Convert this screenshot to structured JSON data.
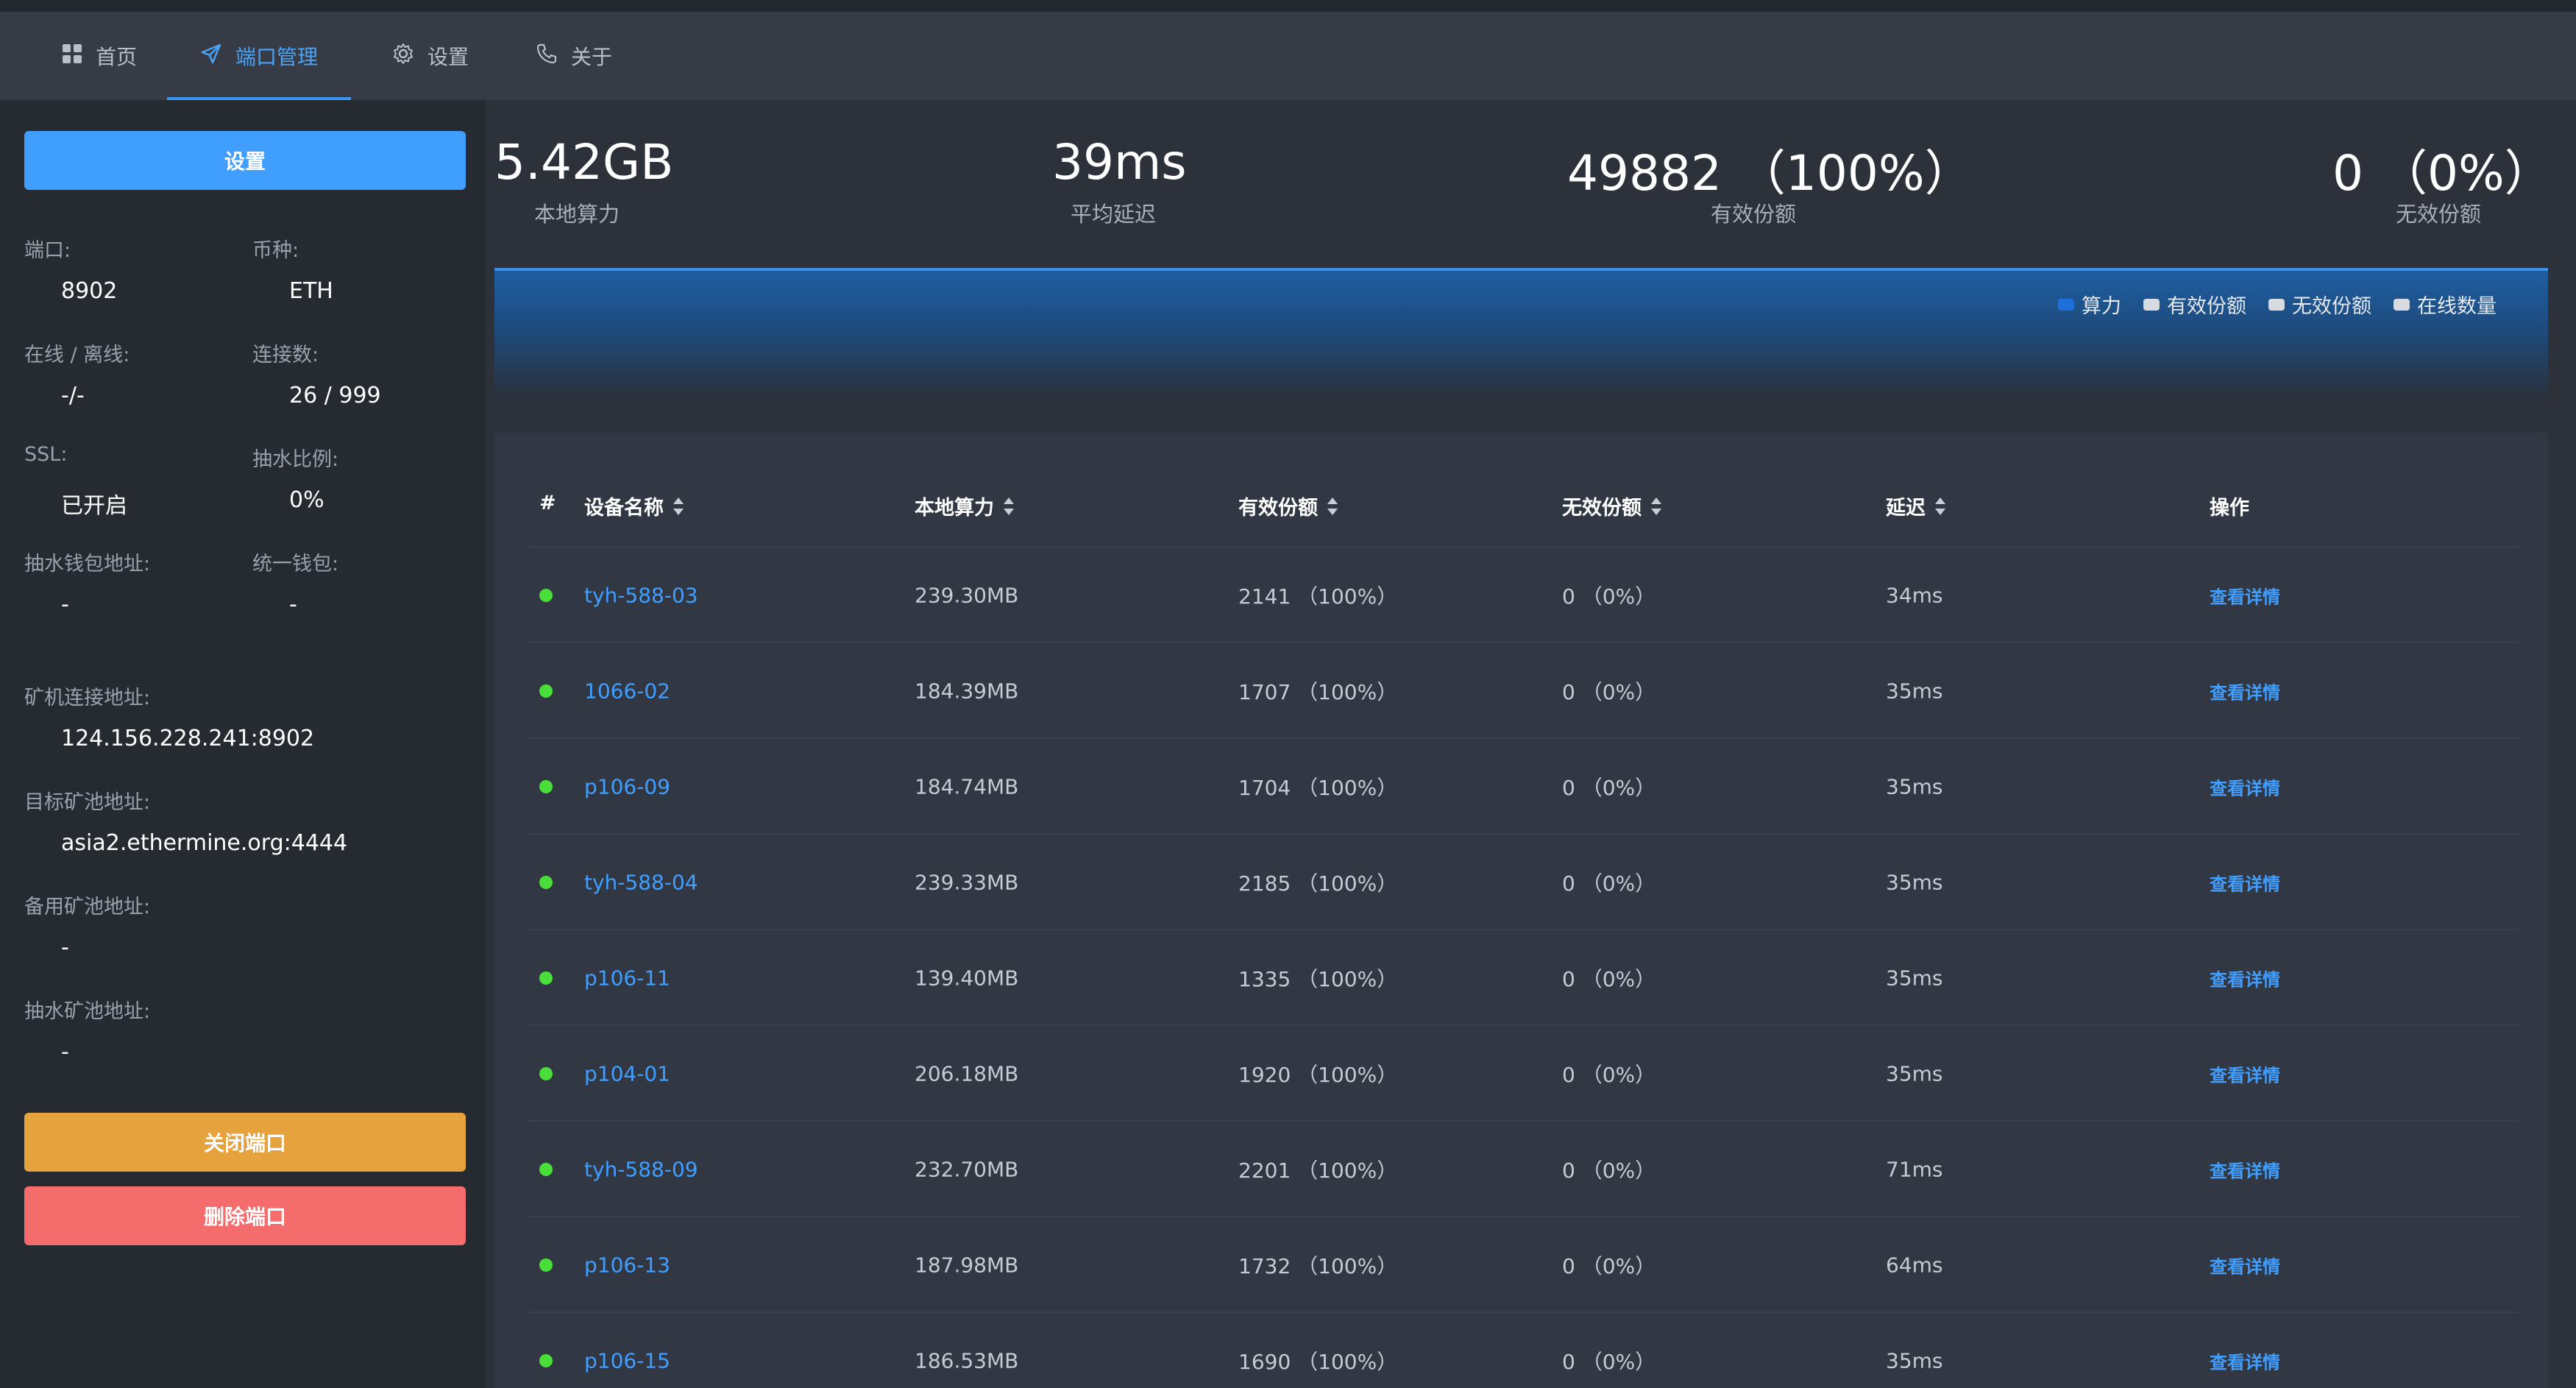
{
  "nav": {
    "items": [
      {
        "label": "首页",
        "icon": "grid-icon"
      },
      {
        "label": "端口管理",
        "icon": "send-icon"
      },
      {
        "label": "设置",
        "icon": "gear-icon"
      },
      {
        "label": "关于",
        "icon": "phone-icon"
      }
    ],
    "active_index": 1
  },
  "sidebar": {
    "settings_button": "设置",
    "port_label": "端口:",
    "port_value": "8902",
    "coin_label": "币种:",
    "coin_value": "ETH",
    "online_label": "在线 / 离线:",
    "online_value": "-/-",
    "connections_label": "连接数:",
    "connections_value": "26 / 999",
    "ssl_label": "SSL:",
    "ssl_value": "已开启",
    "fee_label": "抽水比例:",
    "fee_value": "0%",
    "fee_wallet_label": "抽水钱包地址:",
    "fee_wallet_value": "-",
    "unified_wallet_label": "统一钱包:",
    "unified_wallet_value": "-",
    "miner_addr_label": "矿机连接地址:",
    "miner_addr_value": "124.156.228.241:8902",
    "target_pool_label": "目标矿池地址:",
    "target_pool_value": "asia2.ethermine.org:4444",
    "backup_pool_label": "备用矿池地址:",
    "backup_pool_value": "-",
    "fee_pool_label": "抽水矿池地址:",
    "fee_pool_value": "-",
    "close_button": "关闭端口",
    "delete_button": "删除端口"
  },
  "stats": {
    "hashrate_value": "5.42GB",
    "hashrate_label": "本地算力",
    "latency_value": "39ms",
    "latency_label": "平均延迟",
    "valid_value": "49882 （100%）",
    "valid_label": "有效份额",
    "invalid_value": "0 （0%）",
    "invalid_label": "无效份额"
  },
  "chart_legend": [
    {
      "label": "算力",
      "color": "#1e6fd9"
    },
    {
      "label": "有效份额",
      "color": "#d8dbe0"
    },
    {
      "label": "无效份额",
      "color": "#d8dbe0"
    },
    {
      "label": "在线数量",
      "color": "#d8dbe0"
    }
  ],
  "table": {
    "headers": {
      "index": "#",
      "device": "设备名称",
      "hashrate": "本地算力",
      "valid": "有效份额",
      "invalid": "无效份额",
      "latency": "延迟",
      "action": "操作"
    },
    "rows": [
      {
        "device": "tyh-588-03",
        "hashrate": "239.30MB",
        "valid": "2141 （100%）",
        "invalid": "0 （0%）",
        "latency": "34ms",
        "action": "查看详情"
      },
      {
        "device": "1066-02",
        "hashrate": "184.39MB",
        "valid": "1707 （100%）",
        "invalid": "0 （0%）",
        "latency": "35ms",
        "action": "查看详情"
      },
      {
        "device": "p106-09",
        "hashrate": "184.74MB",
        "valid": "1704 （100%）",
        "invalid": "0 （0%）",
        "latency": "35ms",
        "action": "查看详情"
      },
      {
        "device": "tyh-588-04",
        "hashrate": "239.33MB",
        "valid": "2185 （100%）",
        "invalid": "0 （0%）",
        "latency": "35ms",
        "action": "查看详情"
      },
      {
        "device": "p106-11",
        "hashrate": "139.40MB",
        "valid": "1335 （100%）",
        "invalid": "0 （0%）",
        "latency": "35ms",
        "action": "查看详情"
      },
      {
        "device": "p104-01",
        "hashrate": "206.18MB",
        "valid": "1920 （100%）",
        "invalid": "0 （0%）",
        "latency": "35ms",
        "action": "查看详情"
      },
      {
        "device": "tyh-588-09",
        "hashrate": "232.70MB",
        "valid": "2201 （100%）",
        "invalid": "0 （0%）",
        "latency": "71ms",
        "action": "查看详情"
      },
      {
        "device": "p106-13",
        "hashrate": "187.98MB",
        "valid": "1732 （100%）",
        "invalid": "0 （0%）",
        "latency": "64ms",
        "action": "查看详情"
      },
      {
        "device": "p106-15",
        "hashrate": "186.53MB",
        "valid": "1690 （100%）",
        "invalid": "0 （0%）",
        "latency": "35ms",
        "action": "查看详情"
      }
    ]
  }
}
